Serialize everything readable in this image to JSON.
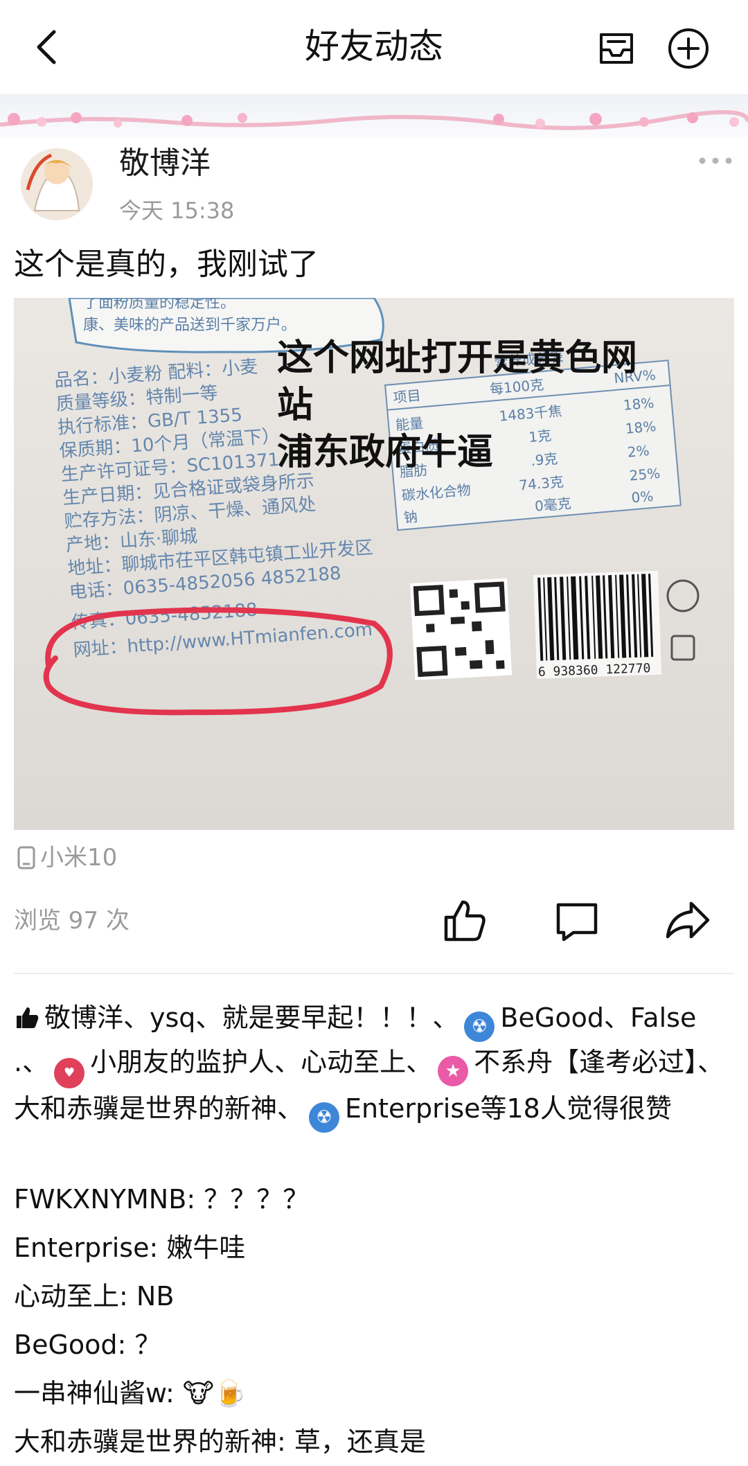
{
  "header": {
    "title": "好友动态",
    "back_icon": "chevron-left-icon",
    "inbox_icon": "inbox-icon",
    "add_icon": "plus-circle-icon"
  },
  "post": {
    "author": "敬博洋",
    "time": "今天 15:38",
    "text": "这个是真的，我刚试了",
    "image": {
      "overlay_caption_line1": "这个网址打开是黄色网",
      "overlay_caption_line2": "站",
      "overlay_caption_line3": "浦东政府牛逼",
      "package_lines": [
        "了面粉质量的稳定性。",
        "康、美味的产品送到千家万户。",
        "品名：小麦粉  配料：小麦",
        "质量等级：特制一等",
        "执行标准：GB/T 1355",
        "保质期：10个月（常温下）",
        "生产许可证号：SC101371",
        "生产日期：见合格证或袋身所示",
        "贮存方法：阴凉、干燥、通风处",
        "产地：山东·聊城",
        "地址：聊城市茌平区韩屯镇工业开发区",
        "电话：0635-4852056 4852188",
        "传真：0635-4852188",
        "网址：http://www.HTmianfen.com"
      ],
      "nutrition_title": "营养成分表",
      "nutrition_header": [
        "项目",
        "每100克",
        "NRV%"
      ],
      "nutrition_rows": [
        [
          "能量",
          "1483千焦",
          "18%"
        ],
        [
          "蛋白质",
          "1克",
          "18%"
        ],
        [
          "脂肪",
          ".9克",
          "2%"
        ],
        [
          "碳水化合物",
          "74.3克",
          "25%"
        ],
        [
          "钠",
          "0毫克",
          "0%"
        ]
      ],
      "barcode_number": "6 938360 122770"
    },
    "device": "小米10",
    "views": "浏览 97 次"
  },
  "actions": {
    "like_icon": "thumbs-up-icon",
    "comment_icon": "comment-icon",
    "share_icon": "share-icon"
  },
  "likes": {
    "seg1": "敬博洋、ysq、就是要早起！！！、",
    "seg2": "BeGood、False .、",
    "seg3": "小朋友的监护人、心动至上、",
    "seg4": "不系舟【逢考必过】、大和赤骥是世界的新神、",
    "seg5": "Enterprise等18人觉得很赞"
  },
  "comments": [
    {
      "name": "FWKXNYMNB",
      "text": "？？？？"
    },
    {
      "name": "Enterprise",
      "text": "嫩牛哇"
    },
    {
      "name": "心动至上",
      "text": "NB"
    },
    {
      "name": "BeGood",
      "text": "？"
    },
    {
      "name": "一串神仙酱w",
      "text": "🐮🍺"
    },
    {
      "name": "大和赤骥是世界的新神",
      "text": "草，还真是"
    }
  ]
}
